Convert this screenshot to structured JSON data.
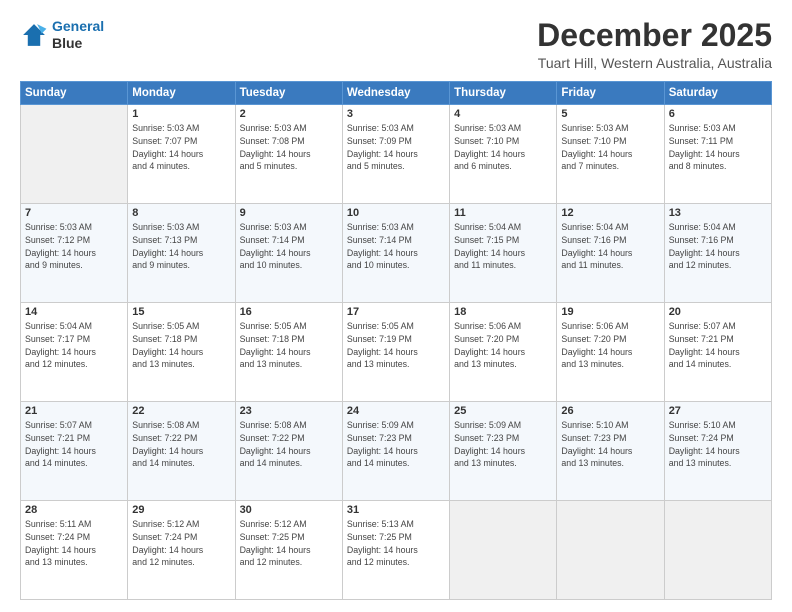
{
  "header": {
    "logo_line1": "General",
    "logo_line2": "Blue",
    "title": "December 2025",
    "subtitle": "Tuart Hill, Western Australia, Australia"
  },
  "weekdays": [
    "Sunday",
    "Monday",
    "Tuesday",
    "Wednesday",
    "Thursday",
    "Friday",
    "Saturday"
  ],
  "weeks": [
    [
      {
        "day": "",
        "info": ""
      },
      {
        "day": "1",
        "info": "Sunrise: 5:03 AM\nSunset: 7:07 PM\nDaylight: 14 hours\nand 4 minutes."
      },
      {
        "day": "2",
        "info": "Sunrise: 5:03 AM\nSunset: 7:08 PM\nDaylight: 14 hours\nand 5 minutes."
      },
      {
        "day": "3",
        "info": "Sunrise: 5:03 AM\nSunset: 7:09 PM\nDaylight: 14 hours\nand 5 minutes."
      },
      {
        "day": "4",
        "info": "Sunrise: 5:03 AM\nSunset: 7:10 PM\nDaylight: 14 hours\nand 6 minutes."
      },
      {
        "day": "5",
        "info": "Sunrise: 5:03 AM\nSunset: 7:10 PM\nDaylight: 14 hours\nand 7 minutes."
      },
      {
        "day": "6",
        "info": "Sunrise: 5:03 AM\nSunset: 7:11 PM\nDaylight: 14 hours\nand 8 minutes."
      }
    ],
    [
      {
        "day": "7",
        "info": "Sunrise: 5:03 AM\nSunset: 7:12 PM\nDaylight: 14 hours\nand 9 minutes."
      },
      {
        "day": "8",
        "info": "Sunrise: 5:03 AM\nSunset: 7:13 PM\nDaylight: 14 hours\nand 9 minutes."
      },
      {
        "day": "9",
        "info": "Sunrise: 5:03 AM\nSunset: 7:14 PM\nDaylight: 14 hours\nand 10 minutes."
      },
      {
        "day": "10",
        "info": "Sunrise: 5:03 AM\nSunset: 7:14 PM\nDaylight: 14 hours\nand 10 minutes."
      },
      {
        "day": "11",
        "info": "Sunrise: 5:04 AM\nSunset: 7:15 PM\nDaylight: 14 hours\nand 11 minutes."
      },
      {
        "day": "12",
        "info": "Sunrise: 5:04 AM\nSunset: 7:16 PM\nDaylight: 14 hours\nand 11 minutes."
      },
      {
        "day": "13",
        "info": "Sunrise: 5:04 AM\nSunset: 7:16 PM\nDaylight: 14 hours\nand 12 minutes."
      }
    ],
    [
      {
        "day": "14",
        "info": "Sunrise: 5:04 AM\nSunset: 7:17 PM\nDaylight: 14 hours\nand 12 minutes."
      },
      {
        "day": "15",
        "info": "Sunrise: 5:05 AM\nSunset: 7:18 PM\nDaylight: 14 hours\nand 13 minutes."
      },
      {
        "day": "16",
        "info": "Sunrise: 5:05 AM\nSunset: 7:18 PM\nDaylight: 14 hours\nand 13 minutes."
      },
      {
        "day": "17",
        "info": "Sunrise: 5:05 AM\nSunset: 7:19 PM\nDaylight: 14 hours\nand 13 minutes."
      },
      {
        "day": "18",
        "info": "Sunrise: 5:06 AM\nSunset: 7:20 PM\nDaylight: 14 hours\nand 13 minutes."
      },
      {
        "day": "19",
        "info": "Sunrise: 5:06 AM\nSunset: 7:20 PM\nDaylight: 14 hours\nand 13 minutes."
      },
      {
        "day": "20",
        "info": "Sunrise: 5:07 AM\nSunset: 7:21 PM\nDaylight: 14 hours\nand 14 minutes."
      }
    ],
    [
      {
        "day": "21",
        "info": "Sunrise: 5:07 AM\nSunset: 7:21 PM\nDaylight: 14 hours\nand 14 minutes."
      },
      {
        "day": "22",
        "info": "Sunrise: 5:08 AM\nSunset: 7:22 PM\nDaylight: 14 hours\nand 14 minutes."
      },
      {
        "day": "23",
        "info": "Sunrise: 5:08 AM\nSunset: 7:22 PM\nDaylight: 14 hours\nand 14 minutes."
      },
      {
        "day": "24",
        "info": "Sunrise: 5:09 AM\nSunset: 7:23 PM\nDaylight: 14 hours\nand 14 minutes."
      },
      {
        "day": "25",
        "info": "Sunrise: 5:09 AM\nSunset: 7:23 PM\nDaylight: 14 hours\nand 13 minutes."
      },
      {
        "day": "26",
        "info": "Sunrise: 5:10 AM\nSunset: 7:23 PM\nDaylight: 14 hours\nand 13 minutes."
      },
      {
        "day": "27",
        "info": "Sunrise: 5:10 AM\nSunset: 7:24 PM\nDaylight: 14 hours\nand 13 minutes."
      }
    ],
    [
      {
        "day": "28",
        "info": "Sunrise: 5:11 AM\nSunset: 7:24 PM\nDaylight: 14 hours\nand 13 minutes."
      },
      {
        "day": "29",
        "info": "Sunrise: 5:12 AM\nSunset: 7:24 PM\nDaylight: 14 hours\nand 12 minutes."
      },
      {
        "day": "30",
        "info": "Sunrise: 5:12 AM\nSunset: 7:25 PM\nDaylight: 14 hours\nand 12 minutes."
      },
      {
        "day": "31",
        "info": "Sunrise: 5:13 AM\nSunset: 7:25 PM\nDaylight: 14 hours\nand 12 minutes."
      },
      {
        "day": "",
        "info": ""
      },
      {
        "day": "",
        "info": ""
      },
      {
        "day": "",
        "info": ""
      }
    ]
  ]
}
